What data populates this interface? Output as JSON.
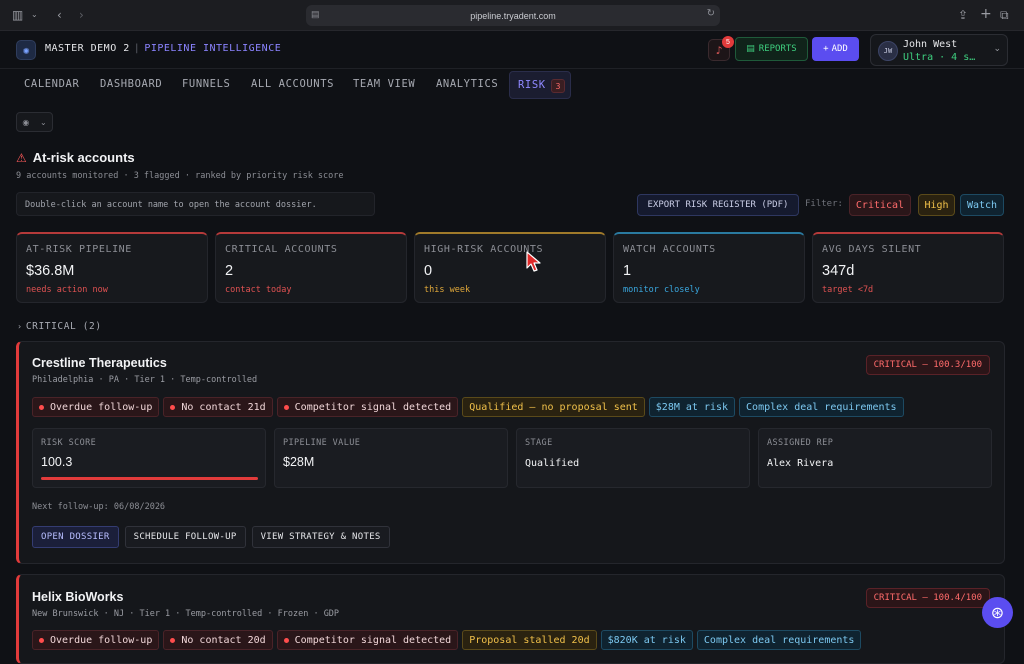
{
  "browser": {
    "url": "pipeline.tryadent.com"
  },
  "header": {
    "workspace": "MASTER DEMO 2",
    "product": "PIPELINE INTELLIGENCE",
    "notification_count": "5",
    "reports_label": "REPORTS",
    "add_label": "ADD",
    "user": {
      "initials": "JW",
      "name": "John West",
      "plan": "Ultra · 4 s…"
    }
  },
  "nav": {
    "tabs": [
      {
        "label": "CALENDAR"
      },
      {
        "label": "DASHBOARD"
      },
      {
        "label": "FUNNELS"
      },
      {
        "label": "ALL ACCOUNTS"
      },
      {
        "label": "TEAM VIEW"
      },
      {
        "label": "ANALYTICS"
      },
      {
        "label": "RISK",
        "count": "3",
        "active": true
      }
    ]
  },
  "risk": {
    "title": "At-risk accounts",
    "subtitle": "9 accounts monitored · 3 flagged · ranked by priority risk score",
    "hint": "Double-click an account name to open the account dossier.",
    "export_label": "EXPORT RISK REGISTER (PDF)",
    "filter_label": "Filter:",
    "filters": [
      "Critical",
      "High",
      "Watch"
    ],
    "stats": [
      {
        "label": "AT-RISK PIPELINE",
        "value": "$36.8M",
        "note": "needs action now",
        "color": "#e05252"
      },
      {
        "label": "CRITICAL ACCOUNTS",
        "value": "2",
        "note": "contact today",
        "color": "#e05252"
      },
      {
        "label": "HIGH-RISK ACCOUNTS",
        "value": "0",
        "note": "this week",
        "color": "#e0a83a"
      },
      {
        "label": "WATCH ACCOUNTS",
        "value": "1",
        "note": "monitor closely",
        "color": "#3aa8e0"
      },
      {
        "label": "AVG DAYS SILENT",
        "value": "347d",
        "note": "target <7d",
        "color": "#e05252"
      }
    ],
    "group_label": "CRITICAL (2)",
    "accounts": [
      {
        "name": "Crestline Therapeutics",
        "location": "Philadelphia · PA · Tier 1 · Temp-controlled",
        "badge": "CRITICAL — 100.3/100",
        "tags": [
          {
            "text": "Overdue follow-up",
            "kind": "red"
          },
          {
            "text": "No contact 21d",
            "kind": "red"
          },
          {
            "text": "Competitor signal detected",
            "kind": "red"
          },
          {
            "text": "Qualified — no proposal sent",
            "kind": "amber"
          },
          {
            "text": "$28M at risk",
            "kind": "blue"
          },
          {
            "text": "Complex deal requirements",
            "kind": "blue"
          }
        ],
        "metrics": [
          {
            "label": "RISK SCORE",
            "value": "100.3",
            "bar": 100
          },
          {
            "label": "PIPELINE VALUE",
            "value": "$28M"
          },
          {
            "label": "STAGE",
            "value": "Qualified"
          },
          {
            "label": "ASSIGNED REP",
            "value": "Alex Rivera"
          }
        ],
        "next_follow_up": "Next follow-up: 06/08/2026",
        "actions": [
          "OPEN DOSSIER",
          "SCHEDULE FOLLOW-UP",
          "VIEW STRATEGY & NOTES"
        ]
      },
      {
        "name": "Helix BioWorks",
        "location": "New Brunswick · NJ · Tier 1 · Temp-controlled · Frozen · GDP",
        "badge": "CRITICAL — 100.4/100",
        "tags": [
          {
            "text": "Overdue follow-up",
            "kind": "red"
          },
          {
            "text": "No contact 20d",
            "kind": "red"
          },
          {
            "text": "Competitor signal detected",
            "kind": "red"
          },
          {
            "text": "Proposal stalled 20d",
            "kind": "amber"
          },
          {
            "text": "$820K at risk",
            "kind": "blue"
          },
          {
            "text": "Complex deal requirements",
            "kind": "blue"
          }
        ]
      }
    ]
  },
  "colors": {
    "accent": "#5b4df0",
    "critical": "#e23b3b",
    "positive": "#3ecf7f"
  }
}
